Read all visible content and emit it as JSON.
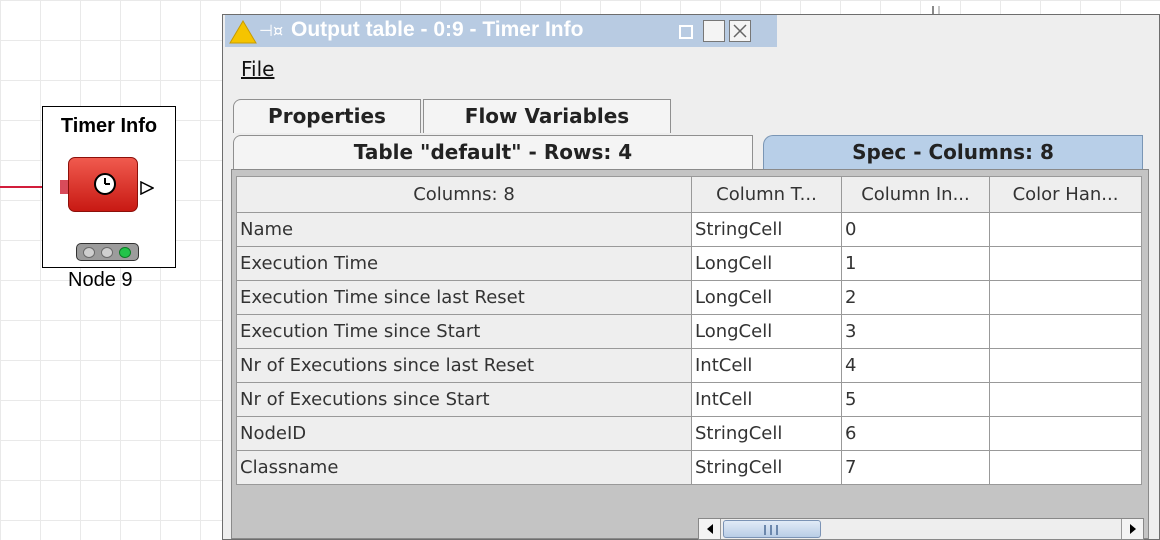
{
  "canvas": {
    "node": {
      "title": "Timer Info",
      "label": "Node 9",
      "accent_color": "#d8261d",
      "status_color": "#22c34a"
    }
  },
  "window": {
    "title": "Output table - 0:9 - Timer Info",
    "titlebar_color": "#b8cbe2"
  },
  "menu": {
    "file_label": "File"
  },
  "tabs": {
    "properties": "Properties",
    "flow_variables": "Flow Variables",
    "table": "Table \"default\" - Rows: 4",
    "spec": "Spec - Columns: 8",
    "active": "spec"
  },
  "table": {
    "headers": [
      "Columns: 8",
      "Column T...",
      "Column In...",
      "Color Han..."
    ],
    "rows": [
      [
        "Name",
        "StringCell",
        "0",
        ""
      ],
      [
        "Execution Time",
        "LongCell",
        "1",
        ""
      ],
      [
        "Execution Time since last Reset",
        "LongCell",
        "2",
        ""
      ],
      [
        "Execution Time since Start",
        "LongCell",
        "3",
        ""
      ],
      [
        "Nr of Executions since last Reset",
        "IntCell",
        "4",
        ""
      ],
      [
        "Nr of Executions since Start",
        "IntCell",
        "5",
        ""
      ],
      [
        "NodeID",
        "StringCell",
        "6",
        ""
      ],
      [
        "Classname",
        "StringCell",
        "7",
        ""
      ]
    ]
  }
}
